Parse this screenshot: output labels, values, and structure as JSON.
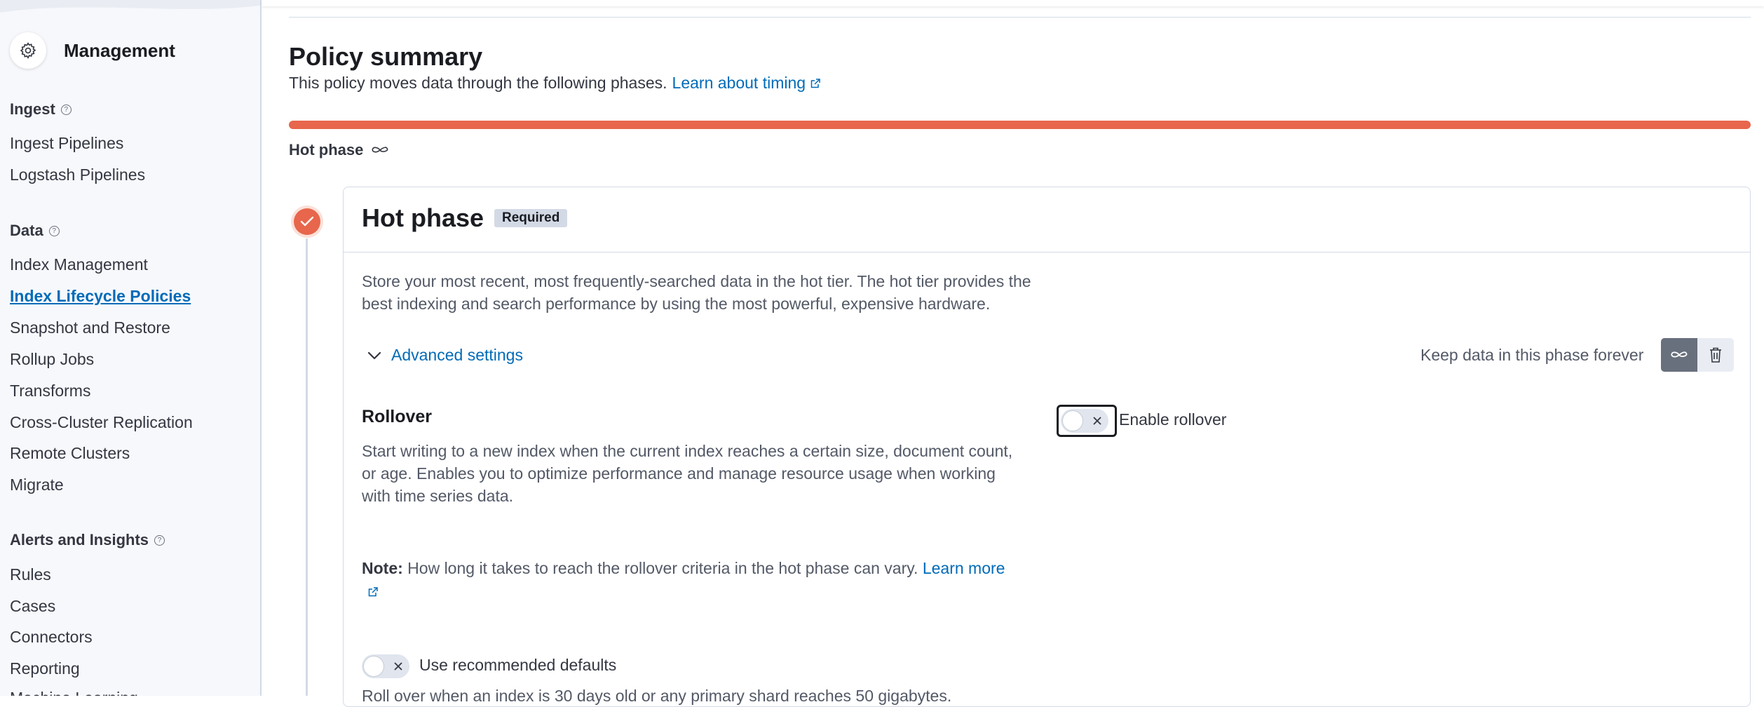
{
  "sidebar": {
    "title": "Management",
    "groups": [
      {
        "label": "Ingest",
        "items": [
          "Ingest Pipelines",
          "Logstash Pipelines"
        ]
      },
      {
        "label": "Data",
        "items": [
          "Index Management",
          "Index Lifecycle Policies",
          "Snapshot and Restore",
          "Rollup Jobs",
          "Transforms",
          "Cross-Cluster Replication",
          "Remote Clusters",
          "Migrate"
        ]
      },
      {
        "label": "Alerts and Insights",
        "items": [
          "Rules",
          "Cases",
          "Connectors",
          "Reporting",
          "Machine Learning"
        ]
      }
    ],
    "active_item": "Index Lifecycle Policies"
  },
  "summary": {
    "title": "Policy summary",
    "description": "This policy moves data through the following phases.",
    "link": "Learn about timing",
    "phase_label": "Hot phase",
    "bar_color": "#e7664c"
  },
  "hot_phase": {
    "title": "Hot phase",
    "badge": "Required",
    "description": "Store your most recent, most frequently-searched data in the hot tier. The hot tier provides the best indexing and search performance by using the most powerful, expensive hardware.",
    "advanced_settings": "Advanced settings",
    "keep_forever": "Keep data in this phase forever",
    "rollover": {
      "title": "Rollover",
      "description": "Start writing to a new index when the current index reaches a certain size, document count, or age. Enables you to optimize performance and manage resource usage when working with time series data.",
      "toggle_label": "Enable rollover",
      "enabled": false,
      "note_prefix": "Note:",
      "note_text": "How long it takes to reach the rollover criteria in the hot phase can vary.",
      "note_link": "Learn more",
      "defaults_label": "Use recommended defaults",
      "defaults_enabled": false,
      "defaults_desc": "Roll over when an index is 30 days old or any primary shard reaches 50 gigabytes."
    }
  },
  "icons": {
    "gear": "gear-icon",
    "help": "question-icon",
    "external": "external-link-icon",
    "infinity": "infinity-icon",
    "check": "check-icon",
    "chevron": "chevron-down-icon",
    "trash": "trash-icon",
    "cross": "cross-icon"
  }
}
